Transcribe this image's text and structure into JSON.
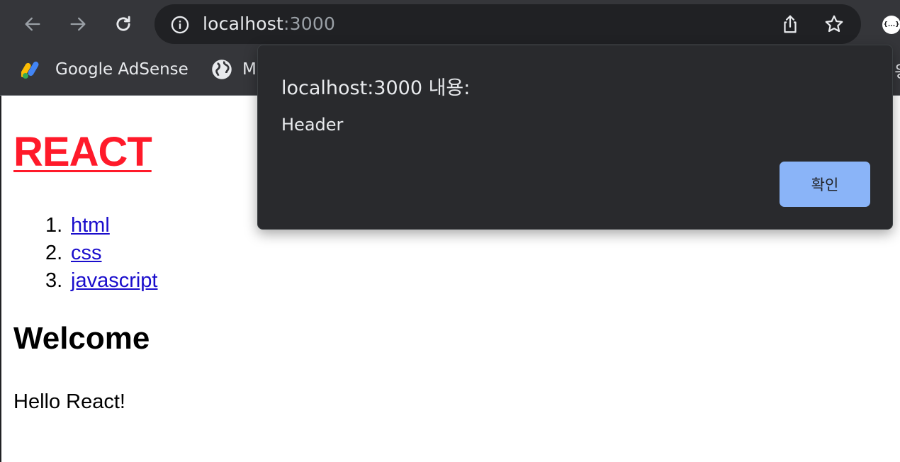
{
  "browser": {
    "url_host": "localhost",
    "url_port": ":3000",
    "extension_label": "{...}",
    "bookmarks": [
      {
        "label": "Google AdSense",
        "icon": "adsense-icon"
      },
      {
        "label": "M",
        "icon": "globe-icon"
      }
    ],
    "bookmark_overflow": "읭"
  },
  "page": {
    "title": "REACT",
    "topics": [
      {
        "num": "1.",
        "label": "html"
      },
      {
        "num": "2.",
        "label": "css"
      },
      {
        "num": "3.",
        "label": "javascript"
      }
    ],
    "heading": "Welcome",
    "body": "Hello React!"
  },
  "dialog": {
    "title": "localhost:3000 내용:",
    "message": "Header",
    "ok_label": "확인"
  },
  "colors": {
    "title_red": "#ff1a2a",
    "link_blue": "#1a0dcc",
    "dialog_bg": "#292a2d",
    "button_blue": "#8ab4f8",
    "chrome_bg": "#35363a"
  }
}
